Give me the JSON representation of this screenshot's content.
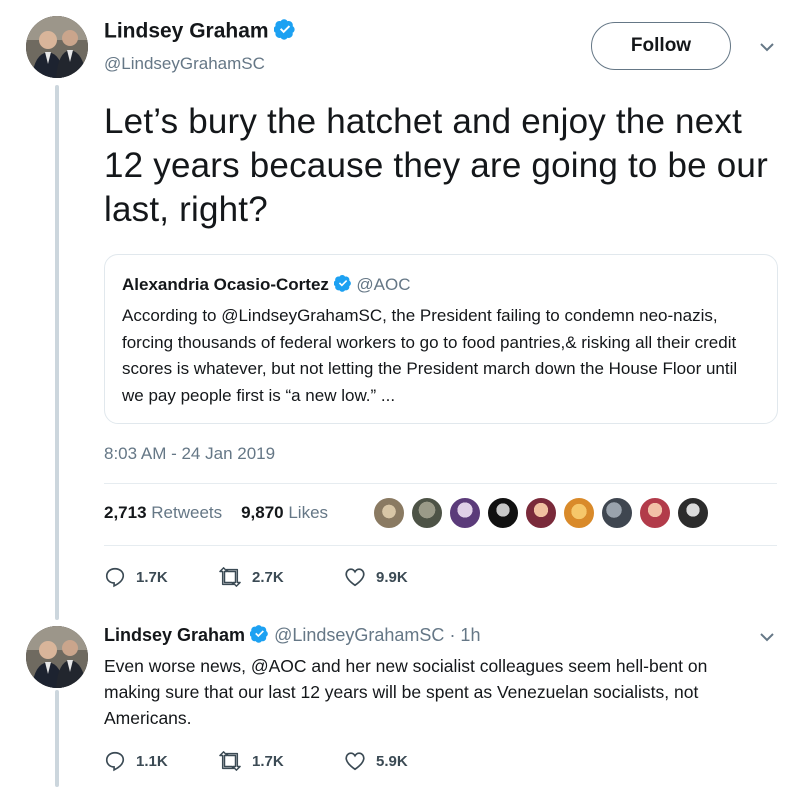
{
  "tweet": {
    "author_name": "Lindsey Graham",
    "author_handle": "@LindseyGrahamSC",
    "follow_label": "Follow",
    "text": "Let’s bury the hatchet and enjoy the next 12 years because they are going to be our last, right?",
    "timestamp": "8:03 AM - 24 Jan 2019",
    "retweets_count": "2,713",
    "retweets_label": "Retweets",
    "likes_count": "9,870",
    "likes_label": "Likes",
    "reply_count": "1.7K",
    "retweet_action_count": "2.7K",
    "like_action_count": "9.9K"
  },
  "quoted_tweet": {
    "author_name": "Alexandria Ocasio-Cortez",
    "author_handle": "@AOC",
    "text": "According to @LindseyGrahamSC, the President failing to condemn neo-nazis, forcing thousands of federal workers to go to food pantries,& risking all their credit scores is whatever, but not letting the President march down the House Floor until we pay people first is “a new low.” ..."
  },
  "reply_tweet": {
    "author_name": "Lindsey Graham",
    "author_handle": "@LindseyGrahamSC",
    "age": "· 1h",
    "text": "Even worse news, @AOC and her new socialist colleagues seem hell-bent on making sure that our last 12 years will be spent as Venezuelan socialists, not Americans.",
    "reply_count": "1.1K",
    "retweet_count": "1.7K",
    "like_count": "5.9K"
  },
  "colors": {
    "verified_blue": "#1da1f2",
    "text_primary": "#14171a",
    "text_secondary": "#657786",
    "border": "#e1e8ed"
  },
  "icons": [
    "verified-badge-icon",
    "chevron-down-icon",
    "reply-icon",
    "retweet-icon",
    "like-icon"
  ]
}
